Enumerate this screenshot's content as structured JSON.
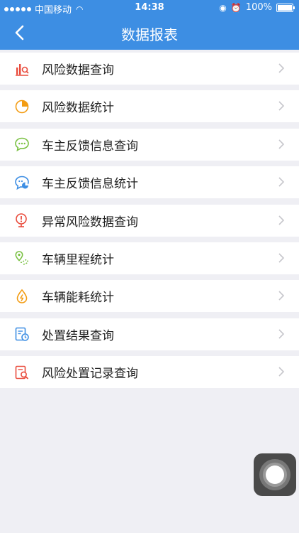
{
  "status_bar": {
    "carrier": "中国移动",
    "time": "14:38",
    "battery": "100%"
  },
  "nav": {
    "title": "数据报表",
    "back_icon": "chevron-left-icon"
  },
  "menu": {
    "items": [
      {
        "label": "风险数据查询",
        "icon": "bar-chart-search-icon",
        "color": "#e94b3c"
      },
      {
        "label": "风险数据统计",
        "icon": "pie-chart-icon",
        "color": "#f39c12"
      },
      {
        "label": "车主反馈信息查询",
        "icon": "chat-bubble-icon",
        "color": "#7ac143"
      },
      {
        "label": "车主反馈信息统计",
        "icon": "chat-stats-icon",
        "color": "#3d8ee3"
      },
      {
        "label": "异常风险数据查询",
        "icon": "alert-search-icon",
        "color": "#e94b3c"
      },
      {
        "label": "车辆里程统计",
        "icon": "location-route-icon",
        "color": "#7ac143"
      },
      {
        "label": "车辆能耗统计",
        "icon": "fuel-drop-icon",
        "color": "#f39c12"
      },
      {
        "label": "处置结果查询",
        "icon": "clipboard-clock-icon",
        "color": "#3d8ee3"
      },
      {
        "label": "风险处置记录查询",
        "icon": "document-search-icon",
        "color": "#e94b3c"
      }
    ]
  },
  "colors": {
    "header": "#3d8ee3",
    "background": "#efeff4"
  }
}
